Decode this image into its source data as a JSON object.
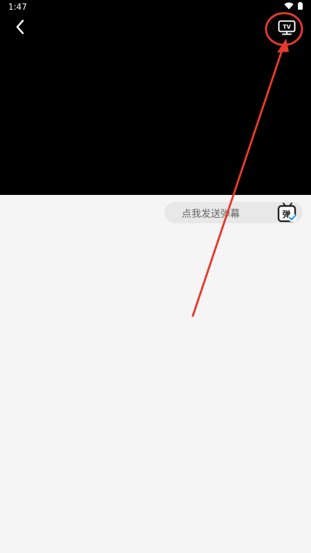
{
  "status_bar": {
    "time": "1:47"
  },
  "player": {
    "back_icon": "chevron-left-icon",
    "tv_icon": "tv-cast-icon",
    "tv_label": "TV"
  },
  "danmaku": {
    "placeholder": "点我发送弹幕",
    "toggle_label": "弹",
    "accent": "#1e9bf0"
  },
  "annotation": {
    "color": "#e53b2d"
  }
}
